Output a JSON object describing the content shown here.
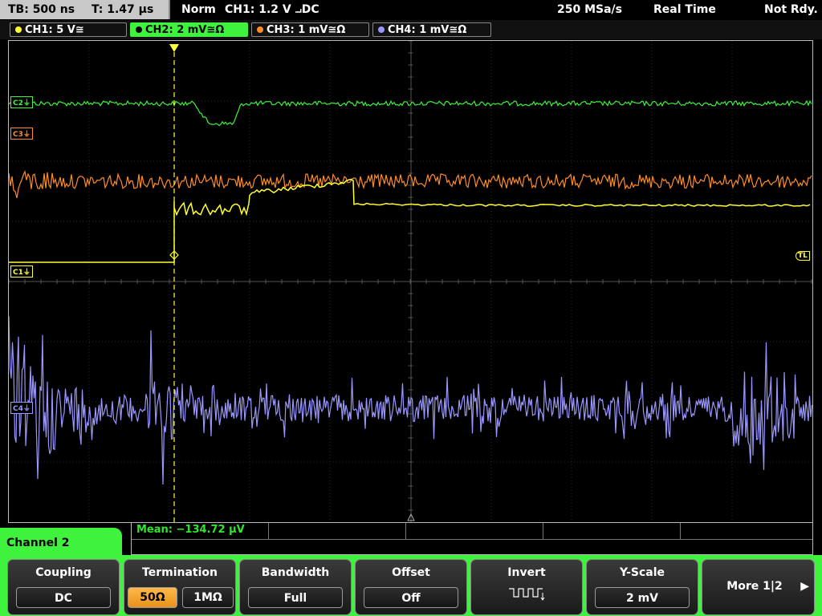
{
  "status": {
    "timebase": "TB: 500 ns",
    "trigger_time": "T: 1.47 µs",
    "mode": "Norm",
    "trigger": "CH1: 1.2 V ⨼DC",
    "sample_rate": "250 MSa/s",
    "acq_mode": "Real Time",
    "state": "Not Rdy."
  },
  "channels": [
    {
      "label": "CH1: 5 V≅",
      "color": "#ffff33"
    },
    {
      "label": "CH2: 2 mV≅Ω",
      "color": "#3ef23e"
    },
    {
      "label": "CH3: 1 mV≅Ω",
      "color": "#ff8c2a"
    },
    {
      "label": "CH4: 1 mV≅Ω",
      "color": "#9a96ff"
    }
  ],
  "markers": {
    "c2": "C2⏚",
    "c3": "C3⏚",
    "c1": "C1⏚",
    "c4": "C4⏚",
    "tl": "TL",
    "trigger_pos": "T"
  },
  "measurement": {
    "mean": "Mean: −134.72 µV"
  },
  "menu_title": "Channel 2",
  "softkeys": {
    "coupling": {
      "label": "Coupling",
      "value": "DC"
    },
    "termination": {
      "label": "Termination",
      "opt1": "50Ω",
      "opt2": "1MΩ"
    },
    "bandwidth": {
      "label": "Bandwidth",
      "value": "Full"
    },
    "offset": {
      "label": "Offset",
      "value": "Off"
    },
    "invert": {
      "label": "Invert"
    },
    "yscale": {
      "label": "Y-Scale",
      "value": "2 mV"
    },
    "more": {
      "label": "More 1|2"
    }
  }
}
